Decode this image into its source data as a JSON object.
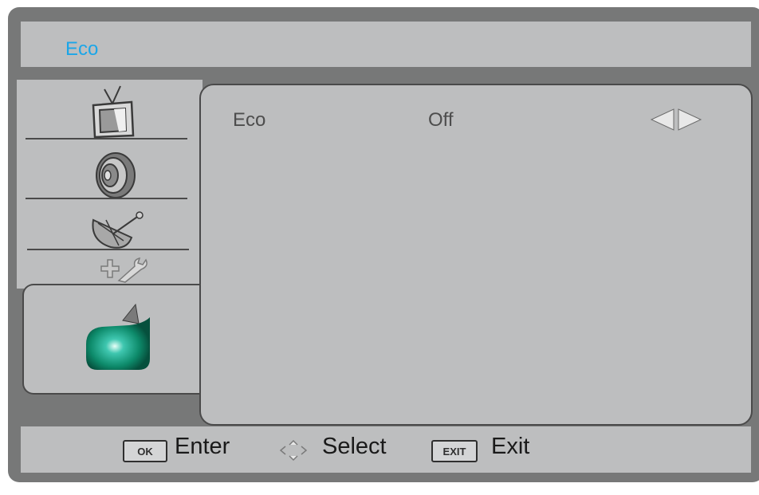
{
  "title": "Eco",
  "menu": {
    "categories": [
      {
        "icon": "tv-icon"
      },
      {
        "icon": "speaker-icon"
      },
      {
        "icon": "satellite-dish-icon"
      },
      {
        "icon": "tools-icon"
      },
      {
        "icon": "eco-leaf-icon",
        "selected": true
      }
    ]
  },
  "setting": {
    "label": "Eco",
    "value": "Off"
  },
  "footer": {
    "ok_key": "OK",
    "enter_label": "Enter",
    "select_label": "Select",
    "exit_key": "EXIT",
    "exit_label": "Exit"
  },
  "colors": {
    "title": "#1ba6e8",
    "frame": "#777878",
    "panel": "#bdbebf"
  }
}
